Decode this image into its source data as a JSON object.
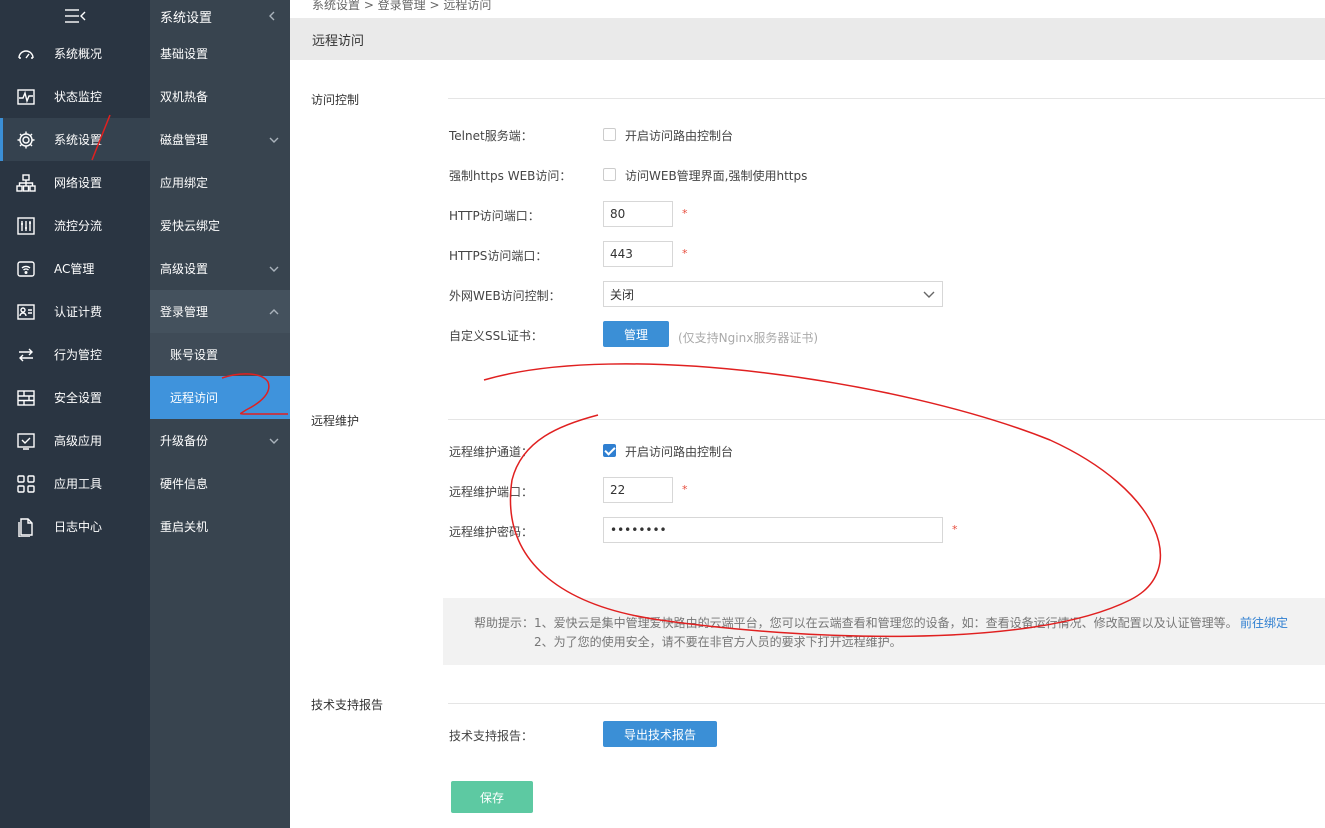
{
  "sidebar": {
    "items": [
      {
        "label": "系统概况",
        "icon": "gauge-icon"
      },
      {
        "label": "状态监控",
        "icon": "pulse-monitor-icon"
      },
      {
        "label": "系统设置",
        "icon": "gear-icon"
      },
      {
        "label": "网络设置",
        "icon": "network-tree-icon"
      },
      {
        "label": "流控分流",
        "icon": "sliders-icon"
      },
      {
        "label": "AC管理",
        "icon": "wifi-box-icon"
      },
      {
        "label": "认证计费",
        "icon": "id-card-icon"
      },
      {
        "label": "行为管控",
        "icon": "swap-arrows-icon"
      },
      {
        "label": "安全设置",
        "icon": "firewall-brick-icon"
      },
      {
        "label": "高级应用",
        "icon": "check-screen-icon"
      },
      {
        "label": "应用工具",
        "icon": "apps-grid-icon"
      },
      {
        "label": "日志中心",
        "icon": "documents-icon"
      }
    ]
  },
  "subnav": {
    "title": "系统设置",
    "items": [
      {
        "label": "基础设置"
      },
      {
        "label": "双机热备"
      },
      {
        "label": "磁盘管理"
      },
      {
        "label": "应用绑定"
      },
      {
        "label": "爱快云绑定"
      },
      {
        "label": "高级设置"
      },
      {
        "label": "登录管理"
      },
      {
        "label": "账号设置"
      },
      {
        "label": "远程访问"
      },
      {
        "label": "升级备份"
      },
      {
        "label": "硬件信息"
      },
      {
        "label": "重启关机"
      }
    ]
  },
  "main": {
    "breadcrumb": "系统设置 > 登录管理 > 远程访问",
    "page_title": "远程访问",
    "access": {
      "title": "访问控制",
      "telnet_label": "Telnet服务端：",
      "telnet_cb": "开启访问路由控制台",
      "https_label": "强制https WEB访问：",
      "https_cb": "访问WEB管理界面,强制使用https",
      "http_port_label": "HTTP访问端口：",
      "http_port": "80",
      "https_port_label": "HTTPS访问端口：",
      "https_port": "443",
      "wan_label": "外网WEB访问控制：",
      "wan_value": "关闭",
      "ssl_label": "自定义SSL证书：",
      "ssl_btn": "管理",
      "ssl_note": "(仅支持Nginx服务器证书)"
    },
    "remote": {
      "title": "远程维护",
      "channel_label": "远程维护通道：",
      "channel_cb": "开启访问路由控制台",
      "channel_checked": true,
      "port_label": "远程维护端口：",
      "port": "22",
      "pwd_label": "远程维护密码：",
      "pwd": "••••••••"
    },
    "help": {
      "prefix": "帮助提示：",
      "line1": "1、爱快云是集中管理爱快路由的云端平台，您可以在云端查看和管理您的设备，如：查看设备运行情况、修改配置以及认证管理等。",
      "link": "前往绑定",
      "line2": "2、为了您的使用安全，请不要在非官方人员的要求下打开远程维护。"
    },
    "report": {
      "title": "技术支持报告",
      "label": "技术支持报告：",
      "btn": "导出技术报告"
    },
    "required_mark": "*",
    "save": "保存"
  },
  "colors": {
    "sidebar_bg": "#2a3542",
    "subnav_bg": "#38444f",
    "accent": "#3b8fd6",
    "save": "#5dc9a2",
    "annotation": "#e02020"
  }
}
